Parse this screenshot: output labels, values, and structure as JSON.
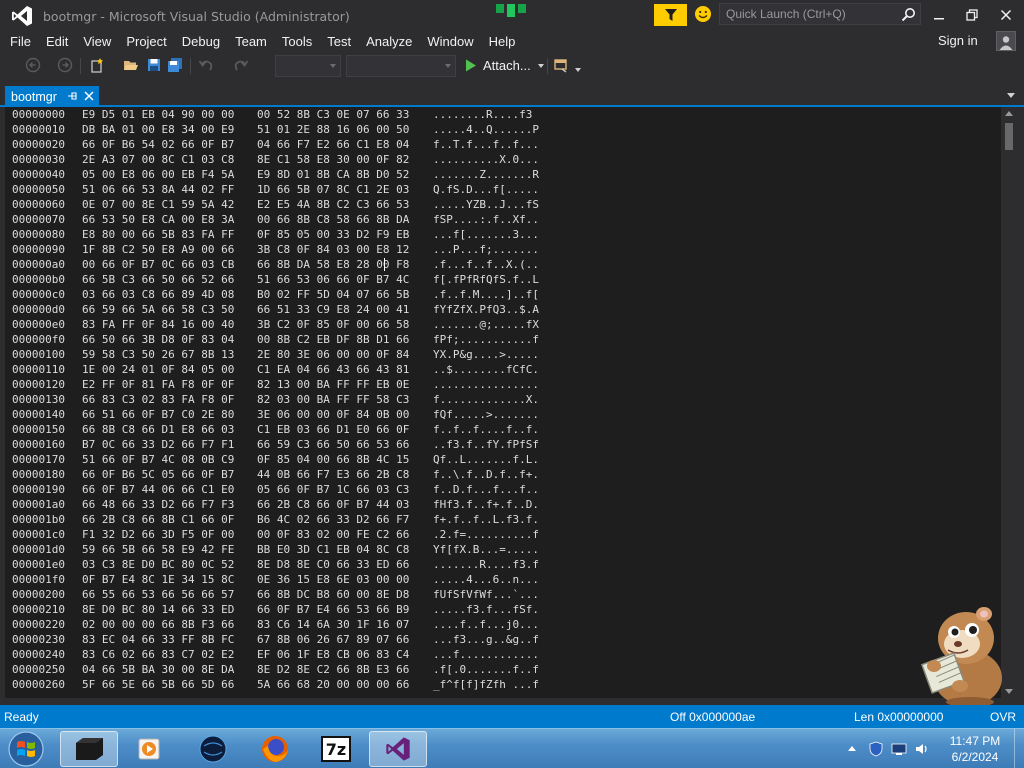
{
  "window": {
    "title": "bootmgr - Microsoft Visual Studio (Administrator)",
    "quick_launch_placeholder": "Quick Launch (Ctrl+Q)",
    "sign_in": "Sign in"
  },
  "menu": [
    "File",
    "Edit",
    "View",
    "Project",
    "Debug",
    "Team",
    "Tools",
    "Test",
    "Analyze",
    "Window",
    "Help"
  ],
  "toolbar": {
    "attach_label": "Attach..."
  },
  "tab": {
    "label": "bootmgr"
  },
  "hex_view": {
    "rows": [
      {
        "addr": "00000000",
        "hex1": "E9 D5 01 EB 04 90 00 00",
        "hex2": "00 52 8B C3 0E 07 66 33",
        "ascii": "........R....f3"
      },
      {
        "addr": "00000010",
        "hex1": "DB BA 01 00 E8 34 00 E9",
        "hex2": "51 01 2E 88 16 06 00 50",
        "ascii": ".....4..Q......P"
      },
      {
        "addr": "00000020",
        "hex1": "66 0F B6 54 02 66 0F B7",
        "hex2": "04 66 F7 E2 66 C1 E8 04",
        "ascii": "f..T.f...f..f..."
      },
      {
        "addr": "00000030",
        "hex1": "2E A3 07 00 8C C1 03 C8",
        "hex2": "8E C1 58 E8 30 00 0F 82",
        "ascii": "..........X.0..."
      },
      {
        "addr": "00000040",
        "hex1": "05 00 E8 06 00 EB F4 5A",
        "hex2": "E9 8D 01 8B CA 8B D0 52",
        "ascii": ".......Z.......R"
      },
      {
        "addr": "00000050",
        "hex1": "51 06 66 53 8A 44 02 FF",
        "hex2": "1D 66 5B 07 8C C1 2E 03",
        "ascii": "Q.fS.D...f[....."
      },
      {
        "addr": "00000060",
        "hex1": "0E 07 00 8E C1 59 5A 42",
        "hex2": "E2 E5 4A 8B C2 C3 66 53",
        "ascii": ".....YZB..J...fS"
      },
      {
        "addr": "00000070",
        "hex1": "66 53 50 E8 CA 00 E8 3A",
        "hex2": "00 66 8B C8 58 66 8B DA",
        "ascii": "fSP....:.f..Xf.."
      },
      {
        "addr": "00000080",
        "hex1": "E8 80 00 66 5B 83 FA FF",
        "hex2": "0F 85 05 00 33 D2 F9 EB",
        "ascii": "...f[.......3..."
      },
      {
        "addr": "00000090",
        "hex1": "1F 8B C2 50 E8 A9 00 66",
        "hex2": "3B C8 0F 84 03 00 E8 12",
        "ascii": "...P...f;......."
      },
      {
        "addr": "000000a0",
        "hex1": "00 66 0F B7 0C 66 03 CB",
        "hex2": "66 8B DA 58 E8 28 00 F8",
        "ascii": ".f...f..f..X.(.."
      },
      {
        "addr": "000000b0",
        "hex1": "66 5B C3 66 50 66 52 66",
        "hex2": "51 66 53 06 66 0F B7 4C",
        "ascii": "f[.fPfRfQfS.f..L"
      },
      {
        "addr": "000000c0",
        "hex1": "03 66 03 C8 66 89 4D 08",
        "hex2": "B0 02 FF 5D 04 07 66 5B",
        "ascii": ".f..f.M....]..f["
      },
      {
        "addr": "000000d0",
        "hex1": "66 59 66 5A 66 58 C3 50",
        "hex2": "66 51 33 C9 E8 24 00 41",
        "ascii": "fYfZfX.PfQ3..$.A"
      },
      {
        "addr": "000000e0",
        "hex1": "83 FA FF 0F 84 16 00 40",
        "hex2": "3B C2 0F 85 0F 00 66 58",
        "ascii": ".......@;.....fX"
      },
      {
        "addr": "000000f0",
        "hex1": "66 50 66 3B D8 0F 83 04",
        "hex2": "00 8B C2 EB DF 8B D1 66",
        "ascii": "fPf;...........f"
      },
      {
        "addr": "00000100",
        "hex1": "59 58 C3 50 26 67 8B 13",
        "hex2": "2E 80 3E 06 00 00 0F 84",
        "ascii": "YX.P&g....>....."
      },
      {
        "addr": "00000110",
        "hex1": "1E 00 24 01 0F 84 05 00",
        "hex2": "C1 EA 04 66 43 66 43 81",
        "ascii": "..$........fCfC."
      },
      {
        "addr": "00000120",
        "hex1": "E2 FF 0F 81 FA F8 0F 0F",
        "hex2": "82 13 00 BA FF FF EB 0E",
        "ascii": "................"
      },
      {
        "addr": "00000130",
        "hex1": "66 83 C3 02 83 FA F8 0F",
        "hex2": "82 03 00 BA FF FF 58 C3",
        "ascii": "f.............X."
      },
      {
        "addr": "00000140",
        "hex1": "66 51 66 0F B7 C0 2E 80",
        "hex2": "3E 06 00 00 0F 84 0B 00",
        "ascii": "fQf.....>......."
      },
      {
        "addr": "00000150",
        "hex1": "66 8B C8 66 D1 E8 66 03",
        "hex2": "C1 EB 03 66 D1 E0 66 0F",
        "ascii": "f..f..f....f..f."
      },
      {
        "addr": "00000160",
        "hex1": "B7 0C 66 33 D2 66 F7 F1",
        "hex2": "66 59 C3 66 50 66 53 66",
        "ascii": "..f3.f..fY.fPfSf"
      },
      {
        "addr": "00000170",
        "hex1": "51 66 0F B7 4C 08 0B C9",
        "hex2": "0F 85 04 00 66 8B 4C 15",
        "ascii": "Qf..L.......f.L."
      },
      {
        "addr": "00000180",
        "hex1": "66 0F B6 5C 05 66 0F B7",
        "hex2": "44 0B 66 F7 E3 66 2B C8",
        "ascii": "f..\\.f..D.f..f+."
      },
      {
        "addr": "00000190",
        "hex1": "66 0F B7 44 06 66 C1 E0",
        "hex2": "05 66 0F B7 1C 66 03 C3",
        "ascii": "f..D.f...f...f.."
      },
      {
        "addr": "000001a0",
        "hex1": "66 48 66 33 D2 66 F7 F3",
        "hex2": "66 2B C8 66 0F B7 44 03",
        "ascii": "fHf3.f..f+.f..D."
      },
      {
        "addr": "000001b0",
        "hex1": "66 2B C8 66 8B C1 66 0F",
        "hex2": "B6 4C 02 66 33 D2 66 F7",
        "ascii": "f+.f..f..L.f3.f."
      },
      {
        "addr": "000001c0",
        "hex1": "F1 32 D2 66 3D F5 0F 00",
        "hex2": "00 0F 83 02 00 FE C2 66",
        "ascii": ".2.f=..........f"
      },
      {
        "addr": "000001d0",
        "hex1": "59 66 5B 66 58 E9 42 FE",
        "hex2": "BB E0 3D C1 EB 04 8C C8",
        "ascii": "Yf[fX.B...=....."
      },
      {
        "addr": "000001e0",
        "hex1": "03 C3 8E D0 BC 80 0C 52",
        "hex2": "8E D8 8E C0 66 33 ED 66",
        "ascii": ".......R....f3.f"
      },
      {
        "addr": "000001f0",
        "hex1": "0F B7 E4 8C 1E 34 15 8C",
        "hex2": "0E 36 15 E8 6E 03 00 00",
        "ascii": ".....4...6..n..."
      },
      {
        "addr": "00000200",
        "hex1": "66 55 66 53 66 56 66 57",
        "hex2": "66 8B DC B8 60 00 8E D8",
        "ascii": "fUfSfVfWf...`..."
      },
      {
        "addr": "00000210",
        "hex1": "8E D0 BC 80 14 66 33 ED",
        "hex2": "66 0F B7 E4 66 53 66 B9",
        "ascii": ".....f3.f...fSf."
      },
      {
        "addr": "00000220",
        "hex1": "02 00 00 00 66 8B F3 66",
        "hex2": "83 C6 14 6A 30 1F 16 07",
        "ascii": "....f..f...j0..."
      },
      {
        "addr": "00000230",
        "hex1": "83 EC 04 66 33 FF 8B FC",
        "hex2": "67 8B 06 26 67 89 07 66",
        "ascii": "...f3...g..&g..f"
      },
      {
        "addr": "00000240",
        "hex1": "83 C6 02 66 83 C7 02 E2",
        "hex2": "EF 06 1F E8 CB 06 83 C4",
        "ascii": "...f............"
      },
      {
        "addr": "00000250",
        "hex1": "04 66 5B BA 30 00 8E DA",
        "hex2": "8E D2 8E C2 66 8B E3 66",
        "ascii": ".f[.0.......f..f"
      },
      {
        "addr": "00000260",
        "hex1": "5F 66 5E 66 5B 66 5D 66",
        "hex2": "5A 66 68 20 00 00 00 66",
        "ascii": "_f^f[f]fZfh ...f"
      }
    ]
  },
  "status": {
    "ready": "Ready",
    "offset": "Off 0x000000ae",
    "length": "Len 0x00000000",
    "mode": "OVR"
  },
  "taskbar": {
    "time": "11:47 PM",
    "date": "6/2/2024",
    "seven_zip_label": "7z"
  },
  "colors": {
    "accent": "#007acc",
    "chrome": "#2d2d30",
    "editor_bg": "#1e1e1e",
    "filter_yellow": "#ffcc00"
  },
  "icons": [
    "visual-studio-logo",
    "filter-icon",
    "smile-feedback-icon",
    "search-icon",
    "minimize-icon",
    "maximize-icon",
    "close-icon",
    "account-icon",
    "pin-icon",
    "play-icon",
    "windows-orb-icon",
    "hamster-mascot-icon"
  ]
}
